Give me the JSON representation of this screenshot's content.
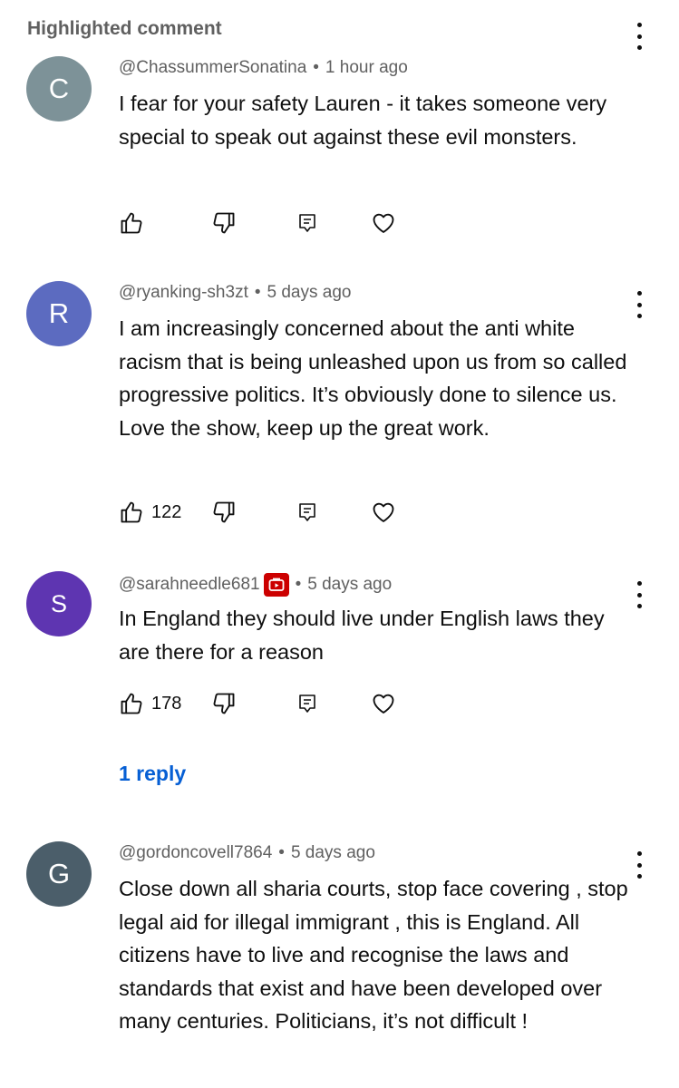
{
  "header": {
    "label": "Highlighted comment"
  },
  "comments": [
    {
      "avatar_letter": "C",
      "avatar_color": "#7d9298",
      "author": "@ChassummerSonatina",
      "time": "1 hour ago",
      "text": "I fear for your safety Lauren - it takes someone very special to speak out against these evil monsters.",
      "likes": ""
    },
    {
      "avatar_letter": "R",
      "avatar_color": "#5c6bc0",
      "author": "@ryanking-sh3zt",
      "time": "5 days ago",
      "text": "I am increasingly concerned about the anti white racism that is being unleashed upon us from so called progressive politics. It’s obviously done to silence us. Love the show, keep up the great work.",
      "likes": "122"
    },
    {
      "avatar_letter": "S",
      "avatar_color": "#5e35b1",
      "author": "@sarahneedle681",
      "time": "5 days ago",
      "text": "In England they should live under English laws they are there for a reason",
      "likes": "178",
      "badge_icon": "youtube-badge-icon",
      "reply_label": "1 reply"
    },
    {
      "avatar_letter": "G",
      "avatar_color": "#4b5e6a",
      "author": "@gordoncovell7864",
      "time": "5 days ago",
      "text": "Close down all sharia courts, stop face covering , stop legal aid for illegal immigrant , this is England. All citizens have to live and recognise the laws and standards that exist and have been developed over many centuries. Politicians, it’s not difficult !",
      "likes": ""
    }
  ],
  "icons": {
    "like": "thumbs-up-icon",
    "dislike": "thumbs-down-icon",
    "reply": "reply-icon",
    "heart": "heart-icon",
    "menu": "more-vert-icon"
  },
  "colors": {
    "link": "#065fd4",
    "secondary_text": "#606060",
    "badge": "#cc0000"
  }
}
